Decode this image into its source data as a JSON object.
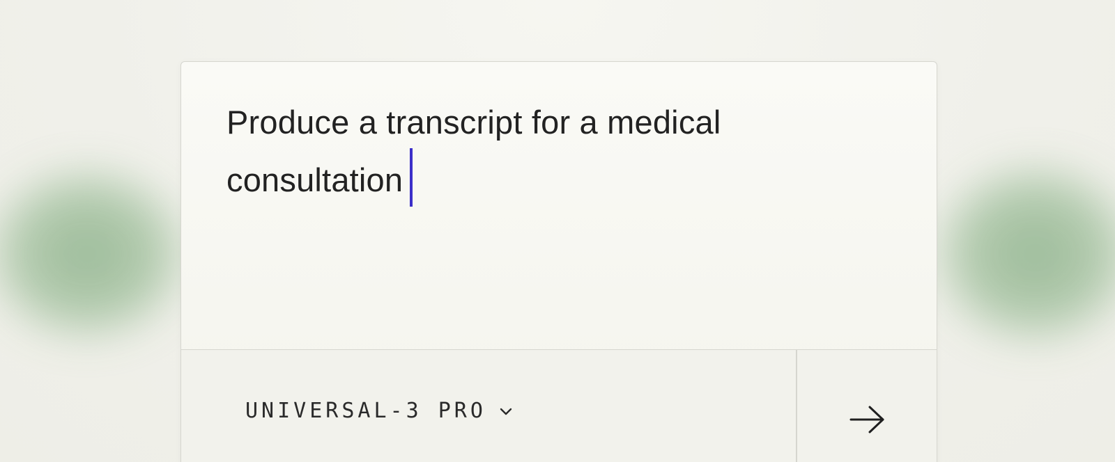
{
  "prompt": {
    "line1": "Produce a transcript for a medical",
    "line2": "consultation"
  },
  "model_selector": {
    "label": "UNIVERSAL-3 PRO",
    "icon": "chevron-down-icon"
  },
  "submit": {
    "icon": "arrow-right-icon"
  },
  "colors": {
    "background": "#f1f1eb",
    "card": "#f8f8f3",
    "border": "#d6d6cf",
    "text": "#222222",
    "caret": "#3b2fc9",
    "blob": "#9dbd98"
  }
}
